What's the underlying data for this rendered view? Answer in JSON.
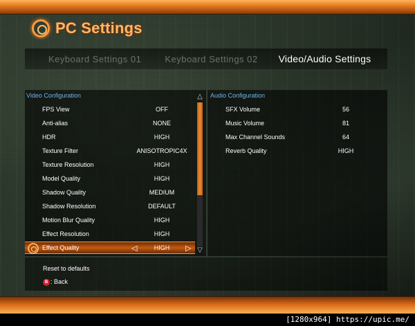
{
  "header": {
    "title": "PC Settings"
  },
  "tabs": [
    {
      "label": "Keyboard Settings 01",
      "active": false
    },
    {
      "label": "Keyboard Settings 02",
      "active": false
    },
    {
      "label": "Video/Audio Settings",
      "active": true
    }
  ],
  "video": {
    "header": "Video Configuration",
    "rows": [
      {
        "label": "FPS View",
        "value": "OFF"
      },
      {
        "label": "Anti-alias",
        "value": "NONE"
      },
      {
        "label": "HDR",
        "value": "HIGH"
      },
      {
        "label": "Texture Filter",
        "value": "ANISOTROPIC4X"
      },
      {
        "label": "Texture Resolution",
        "value": "HIGH"
      },
      {
        "label": "Model Quality",
        "value": "HIGH"
      },
      {
        "label": "Shadow Quality",
        "value": "MEDIUM"
      },
      {
        "label": "Shadow Resolution",
        "value": "DEFAULT"
      },
      {
        "label": "Motion Blur Quality",
        "value": "HIGH"
      },
      {
        "label": "Effect Resolution",
        "value": "HIGH"
      },
      {
        "label": "Effect Quality",
        "value": "HIGH",
        "selected": true
      }
    ]
  },
  "audio": {
    "header": "Audio Configuration",
    "rows": [
      {
        "label": "SFX Volume",
        "value": "56"
      },
      {
        "label": "Music Volume",
        "value": "81"
      },
      {
        "label": "Max Channel Sounds",
        "value": "64"
      },
      {
        "label": "Reverb Quality",
        "value": "HIGH"
      }
    ]
  },
  "footer": {
    "reset_label": "Reset to defaults",
    "back_button_glyph": "B",
    "back_label": ": Back"
  },
  "caption": "[1280x964] https://upic.me/",
  "colors": {
    "accent": "#e0771e",
    "section_header": "#6fb3e8",
    "back_button": "#d2232a"
  }
}
